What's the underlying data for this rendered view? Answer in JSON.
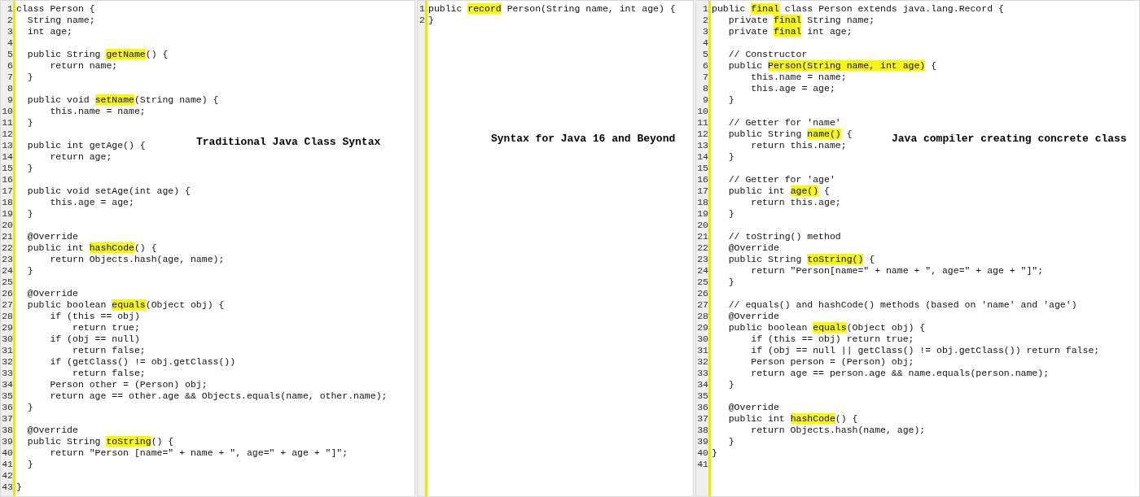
{
  "panels": [
    {
      "caption": "Traditional Java Class Syntax",
      "lines": [
        {
          "number": "1",
          "parts": [
            {
              "text": "class Person {",
              "highlighted": false
            }
          ]
        },
        {
          "number": "2",
          "parts": [
            {
              "text": "  String name;",
              "highlighted": false
            }
          ]
        },
        {
          "number": "3",
          "parts": [
            {
              "text": "  int age;",
              "highlighted": false
            }
          ]
        },
        {
          "number": "4"
        },
        {
          "number": "5",
          "parts": [
            {
              "text": "  public String ",
              "highlighted": false
            },
            {
              "text": "getName",
              "highlighted": true
            },
            {
              "text": "() {",
              "highlighted": false
            }
          ]
        },
        {
          "number": "6",
          "parts": [
            {
              "text": "      return name;",
              "highlighted": false
            }
          ]
        },
        {
          "number": "7",
          "parts": [
            {
              "text": "  }",
              "highlighted": false
            }
          ]
        },
        {
          "number": "8"
        },
        {
          "number": "9",
          "parts": [
            {
              "text": "  public void ",
              "highlighted": false
            },
            {
              "text": "setName",
              "highlighted": true
            },
            {
              "text": "(String name) {",
              "highlighted": false
            }
          ]
        },
        {
          "number": "10",
          "parts": [
            {
              "text": "      this.name = name;",
              "highlighted": false
            }
          ]
        },
        {
          "number": "11",
          "parts": [
            {
              "text": "  }",
              "highlighted": false
            }
          ]
        },
        {
          "number": "12"
        },
        {
          "number": "13",
          "parts": [
            {
              "text": "  public int getAge() {",
              "highlighted": false
            }
          ]
        },
        {
          "number": "14",
          "parts": [
            {
              "text": "      return age;",
              "highlighted": false
            }
          ]
        },
        {
          "number": "15",
          "parts": [
            {
              "text": "  }",
              "highlighted": false
            }
          ]
        },
        {
          "number": "16"
        },
        {
          "number": "17",
          "parts": [
            {
              "text": "  public void setAge(int age) {",
              "highlighted": false
            }
          ]
        },
        {
          "number": "18",
          "parts": [
            {
              "text": "      this.age = age;",
              "highlighted": false
            }
          ]
        },
        {
          "number": "19",
          "parts": [
            {
              "text": "  }",
              "highlighted": false
            }
          ]
        },
        {
          "number": "20"
        },
        {
          "number": "21",
          "parts": [
            {
              "text": "  @Override",
              "highlighted": false
            }
          ]
        },
        {
          "number": "22",
          "parts": [
            {
              "text": "  public int ",
              "highlighted": false
            },
            {
              "text": "hashCode",
              "highlighted": true
            },
            {
              "text": "() {",
              "highlighted": false
            }
          ]
        },
        {
          "number": "23",
          "parts": [
            {
              "text": "      return Objects.hash(age, name);",
              "highlighted": false
            }
          ]
        },
        {
          "number": "24",
          "parts": [
            {
              "text": "  }",
              "highlighted": false
            }
          ]
        },
        {
          "number": "25"
        },
        {
          "number": "26",
          "parts": [
            {
              "text": "  @Override",
              "highlighted": false
            }
          ]
        },
        {
          "number": "27",
          "parts": [
            {
              "text": "  public boolean ",
              "highlighted": false
            },
            {
              "text": "equals",
              "highlighted": true
            },
            {
              "text": "(Object obj) {",
              "highlighted": false
            }
          ]
        },
        {
          "number": "28",
          "parts": [
            {
              "text": "      if (this == obj)",
              "highlighted": false
            }
          ]
        },
        {
          "number": "29",
          "parts": [
            {
              "text": "          return true;",
              "highlighted": false
            }
          ]
        },
        {
          "number": "30",
          "parts": [
            {
              "text": "      if (obj == null)",
              "highlighted": false
            }
          ]
        },
        {
          "number": "31",
          "parts": [
            {
              "text": "          return false;",
              "highlighted": false
            }
          ]
        },
        {
          "number": "32",
          "parts": [
            {
              "text": "      if (getClass() != obj.getClass())",
              "highlighted": false
            }
          ]
        },
        {
          "number": "33",
          "parts": [
            {
              "text": "          return false;",
              "highlighted": false
            }
          ]
        },
        {
          "number": "34",
          "parts": [
            {
              "text": "      Person other = (Person) obj;",
              "highlighted": false
            }
          ]
        },
        {
          "number": "35",
          "parts": [
            {
              "text": "      return age == other.age && Objects.equals(name, other.name);",
              "highlighted": false
            }
          ]
        },
        {
          "number": "36",
          "parts": [
            {
              "text": "  }",
              "highlighted": false
            }
          ]
        },
        {
          "number": "37"
        },
        {
          "number": "38",
          "parts": [
            {
              "text": "  @Override",
              "highlighted": false
            }
          ]
        },
        {
          "number": "39",
          "parts": [
            {
              "text": "  public String ",
              "highlighted": false
            },
            {
              "text": "toString",
              "highlighted": true
            },
            {
              "text": "() {",
              "highlighted": false
            }
          ]
        },
        {
          "number": "40",
          "parts": [
            {
              "text": "      return \"Person [name=\" + name + \", age=\" + age + \"]\";",
              "highlighted": false
            }
          ]
        },
        {
          "number": "41",
          "parts": [
            {
              "text": "  }",
              "highlighted": false
            }
          ]
        },
        {
          "number": "42"
        },
        {
          "number": "43",
          "parts": [
            {
              "text": "}",
              "highlighted": false
            }
          ]
        }
      ]
    },
    {
      "caption": "Syntax for Java 16 and Beyond",
      "lines": [
        {
          "number": "1",
          "parts": [
            {
              "text": "public ",
              "highlighted": false
            },
            {
              "text": "record",
              "highlighted": true
            },
            {
              "text": " Person(String name, int age) {",
              "highlighted": false
            }
          ]
        },
        {
          "number": "2",
          "parts": [
            {
              "text": "}",
              "highlighted": false
            }
          ]
        }
      ]
    },
    {
      "caption": "Java compiler creating concrete class",
      "lines": [
        {
          "number": "1",
          "parts": [
            {
              "text": "public ",
              "highlighted": false
            },
            {
              "text": "final",
              "highlighted": true
            },
            {
              "text": " class Person extends java.lang.Record {",
              "highlighted": false
            }
          ]
        },
        {
          "number": "2",
          "parts": [
            {
              "text": "   private ",
              "highlighted": false
            },
            {
              "text": "final",
              "highlighted": true
            },
            {
              "text": " String name;",
              "highlighted": false
            }
          ]
        },
        {
          "number": "3",
          "parts": [
            {
              "text": "   private ",
              "highlighted": false
            },
            {
              "text": "final",
              "highlighted": true
            },
            {
              "text": " int age;",
              "highlighted": false
            }
          ]
        },
        {
          "number": "4"
        },
        {
          "number": "5",
          "parts": [
            {
              "text": "   // Constructor",
              "highlighted": false
            }
          ]
        },
        {
          "number": "6",
          "parts": [
            {
              "text": "   public ",
              "highlighted": false
            },
            {
              "text": "Person(String name, int age)",
              "highlighted": true
            },
            {
              "text": " {",
              "highlighted": false
            }
          ]
        },
        {
          "number": "7",
          "parts": [
            {
              "text": "       this.name = name;",
              "highlighted": false
            }
          ]
        },
        {
          "number": "8",
          "parts": [
            {
              "text": "       this.age = age;",
              "highlighted": false
            }
          ]
        },
        {
          "number": "9",
          "parts": [
            {
              "text": "   }",
              "highlighted": false
            }
          ]
        },
        {
          "number": "10"
        },
        {
          "number": "11",
          "parts": [
            {
              "text": "   // Getter for 'name'",
              "highlighted": false
            }
          ]
        },
        {
          "number": "12",
          "parts": [
            {
              "text": "   public String ",
              "highlighted": false
            },
            {
              "text": "name()",
              "highlighted": true
            },
            {
              "text": " {",
              "highlighted": false
            }
          ]
        },
        {
          "number": "13",
          "parts": [
            {
              "text": "       return this.name;",
              "highlighted": false
            }
          ]
        },
        {
          "number": "14",
          "parts": [
            {
              "text": "   }",
              "highlighted": false
            }
          ]
        },
        {
          "number": "15"
        },
        {
          "number": "16",
          "parts": [
            {
              "text": "   // Getter for 'age'",
              "highlighted": false
            }
          ]
        },
        {
          "number": "17",
          "parts": [
            {
              "text": "   public int ",
              "highlighted": false
            },
            {
              "text": "age()",
              "highlighted": true
            },
            {
              "text": " {",
              "highlighted": false
            }
          ]
        },
        {
          "number": "18",
          "parts": [
            {
              "text": "       return this.age;",
              "highlighted": false
            }
          ]
        },
        {
          "number": "19",
          "parts": [
            {
              "text": "   }",
              "highlighted": false
            }
          ]
        },
        {
          "number": "20"
        },
        {
          "number": "21",
          "parts": [
            {
              "text": "   // toString() method",
              "highlighted": false
            }
          ]
        },
        {
          "number": "22",
          "parts": [
            {
              "text": "   @Override",
              "highlighted": false
            }
          ]
        },
        {
          "number": "23",
          "parts": [
            {
              "text": "   public String ",
              "highlighted": false
            },
            {
              "text": "toString()",
              "highlighted": true
            },
            {
              "text": " {",
              "highlighted": false
            }
          ]
        },
        {
          "number": "24",
          "parts": [
            {
              "text": "       return \"Person[name=\" + name + \", age=\" + age + \"]\";",
              "highlighted": false
            }
          ]
        },
        {
          "number": "25",
          "parts": [
            {
              "text": "   }",
              "highlighted": false
            }
          ]
        },
        {
          "number": "26"
        },
        {
          "number": "27",
          "parts": [
            {
              "text": "   // equals() and hashCode() methods (based on 'name' and 'age')",
              "highlighted": false
            }
          ]
        },
        {
          "number": "28",
          "parts": [
            {
              "text": "   @Override",
              "highlighted": false
            }
          ]
        },
        {
          "number": "29",
          "parts": [
            {
              "text": "   public boolean ",
              "highlighted": false
            },
            {
              "text": "equals",
              "highlighted": true
            },
            {
              "text": "(Object obj) {",
              "highlighted": false
            }
          ]
        },
        {
          "number": "30",
          "parts": [
            {
              "text": "       if (this == obj) return true;",
              "highlighted": false
            }
          ]
        },
        {
          "number": "31",
          "parts": [
            {
              "text": "       if (obj == null || getClass() != obj.getClass()) return false;",
              "highlighted": false
            }
          ]
        },
        {
          "number": "32",
          "parts": [
            {
              "text": "       Person person = (Person) obj;",
              "highlighted": false
            }
          ]
        },
        {
          "number": "33",
          "parts": [
            {
              "text": "       return age == person.age && name.equals(person.name);",
              "highlighted": false
            }
          ]
        },
        {
          "number": "34",
          "parts": [
            {
              "text": "   }",
              "highlighted": false
            }
          ]
        },
        {
          "number": "35"
        },
        {
          "number": "36",
          "parts": [
            {
              "text": "   @Override",
              "highlighted": false
            }
          ]
        },
        {
          "number": "37",
          "parts": [
            {
              "text": "   public int ",
              "highlighted": false
            },
            {
              "text": "hashCode",
              "highlighted": true
            },
            {
              "text": "() {",
              "highlighted": false
            }
          ]
        },
        {
          "number": "38",
          "parts": [
            {
              "text": "       return Objects.hash(name, age);",
              "highlighted": false
            }
          ]
        },
        {
          "number": "39",
          "parts": [
            {
              "text": "   }",
              "highlighted": false
            }
          ]
        },
        {
          "number": "40",
          "parts": [
            {
              "text": "}",
              "highlighted": false
            }
          ]
        },
        {
          "number": "41"
        }
      ]
    }
  ]
}
